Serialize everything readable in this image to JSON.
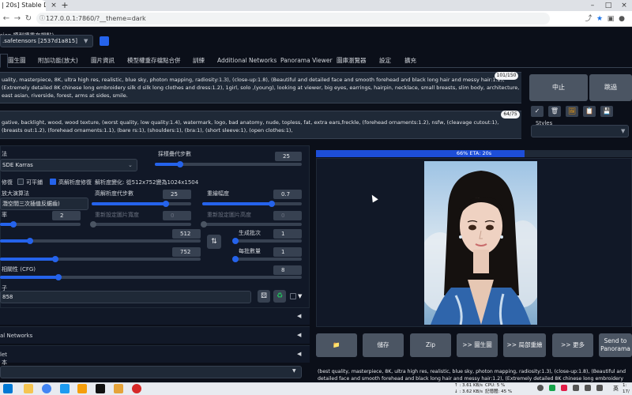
{
  "browser": {
    "tab_title": "| 20s] Stable Diffusion",
    "tab_close": "×",
    "tab_new": "+",
    "address": "127.0.0.1:7860/?__theme=dark",
    "win_minimize": "–",
    "win_maximize": "□",
    "win_close": "×"
  },
  "checkpoint": {
    "label": "sion 模型權重存檔點)",
    "value": ".safetensors [2537d1a815]"
  },
  "tabs": [
    "圖生圖",
    "附加功能(放大)",
    "圖片資訊",
    "模型權重存檔點合併",
    "訓練",
    "Additional Networks",
    "Panorama Viewer",
    "圖庫瀏覽器",
    "設定",
    "擴充"
  ],
  "prompt": {
    "text": "uality, masterpiece, 8K, ultra high res, realistic, blue sky, photon mapping, radiosity:1.3), (close-up:1.8), (Beautiful and detailed face and smooth forehead and black long hair and messy hair:1.2), (Extremely detailed 8K chinese long embroidery silk d silk long clothes and dress:1.2), 1girl, solo ,(young), looking at viewer, big eyes, earrings, hairpin, necklace, small breasts, slim body, architecture, east asian, riverside, forest, arms at sides, smile.",
    "count": "101/150"
  },
  "negative": {
    "text": "gative, backlight, wood, wood texture, (worst quality, low quality:1.4), watermark, logo, bad anatomy, nude, topless, fat, extra ears,freckle, (forehead ornaments:1.2), nsfw, (cleavage cutout:1), (breasts out:1.2), (forehead ornaments:1.1), (bare rs:1), (shoulders:1), (bra:1), (short sleeve:1), (open clothes:1),",
    "count": "64/75"
  },
  "action_buttons": {
    "interrupt": "中止",
    "skip": "跳過"
  },
  "tool_buttons": [
    "✓",
    "🗑",
    "🖼",
    "📋",
    "💾"
  ],
  "styles_label": "Styles",
  "settings": {
    "sampler_label": "法",
    "sampler_value": "SDE Karras",
    "steps_label": "採樣疊代步數",
    "steps_value": "25",
    "restore_faces": "修復",
    "tiling": "可平鋪",
    "hires_fix": "高解析度修復",
    "hires_info": "解析度變化: 從512x752變為1024x1504",
    "upscaler_label": "放大演算法",
    "upscaler_value": "潛空間三次插值反鋸齒)",
    "hires_steps_label": "高解析度代步數",
    "hires_steps_value": "25",
    "denoise_label": "重繪幅度",
    "denoise_value": "0.7",
    "scale_label": "率",
    "scale_value": "2",
    "resize_w_label": "重新設定圖片寬度",
    "resize_w_value": "0",
    "resize_h_label": "重新設定圖片高度",
    "resize_h_value": "0",
    "width_value": "512",
    "height_value": "752",
    "swap_icon": "⇅",
    "batch_count_label": "生成批次",
    "batch_count_value": "1",
    "batch_size_label": "每批數量",
    "batch_size_value": "1",
    "cfg_label": "相關性 (CFG)",
    "cfg_value": "8",
    "seed_label": "子",
    "seed_value": "858",
    "seed_dice": "⚄",
    "seed_recycle": "♻",
    "seed_extra": "▼"
  },
  "accordions": [
    {
      "label": "",
      "arrow": "◀"
    },
    {
      "label": "al Networks",
      "arrow": "◀"
    },
    {
      "label": "let",
      "arrow": "◀"
    },
    {
      "label": "本",
      "arrow": "▼"
    }
  ],
  "progress": {
    "text": "66% ETA: 20s",
    "fraction": 0.66
  },
  "output_buttons": [
    "📁",
    "儲存",
    "Zip",
    ">> 圖生圖",
    ">> 局部重繪",
    ">> 更多",
    "Send to Panorama"
  ],
  "output_text": "(best quality, masterpiece, 8K, ultra high res, realistic, blue sky, photon mapping, radiosity:1.3), (close-up:1.8), (Beautiful and detailed face and smooth forehead and black long hair and messy hair:1.2), (Extremely detailed 8K chinese long embroidery silk robe and silk long clothes and dress:1.2), 1girl",
  "taskbar": {
    "net_up": "↑ : 3.61 KB/s",
    "net_down": "↓ : 3.62 KB/s",
    "cpu": "CPU: 5 %",
    "mem": "記憶體: 45 %",
    "ime": "英",
    "time": "1:",
    "date": "17/"
  },
  "colors": {
    "accent": "#2563eb",
    "background": "#0b0f19",
    "panel": "#111827"
  }
}
